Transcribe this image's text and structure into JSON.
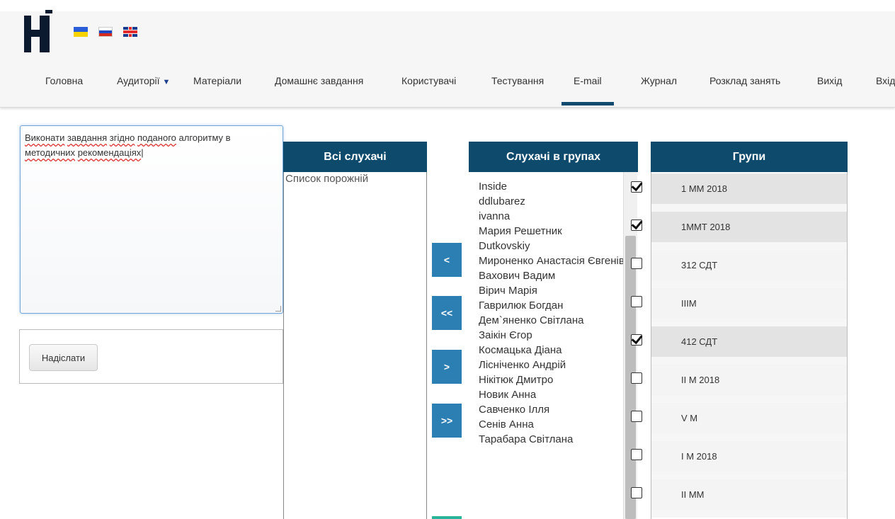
{
  "header": {
    "nav": [
      {
        "label": "Головна"
      },
      {
        "label": "Аудиторії",
        "has_dropdown": true
      },
      {
        "label": "Матеріали"
      },
      {
        "label": "Домашнє завдання"
      },
      {
        "label": "Користувачі"
      },
      {
        "label": "Тестування"
      },
      {
        "label": "E-mail",
        "active": true
      },
      {
        "label": "Журнал"
      },
      {
        "label": "Розклад занять"
      },
      {
        "label": "Вихід"
      },
      {
        "label": "Вхід"
      }
    ],
    "accent_color": "#0e4a6d"
  },
  "message": {
    "text_part1": "Виконати",
    "text_part2": "завдання",
    "text_part3": "згідно",
    "text_part4": "поданого",
    "text_part5": "алгоритму в",
    "text_part6": "методичних",
    "text_part7": "рекомендаціях"
  },
  "send_button": {
    "label": "Надіслати"
  },
  "all_listeners": {
    "title": "Всі слухачі",
    "empty_text": "Список порожній"
  },
  "move_buttons": [
    "<",
    "<<",
    ">",
    ">>"
  ],
  "group_listeners": {
    "title": "Слухачі в групах",
    "names": [
      "Inside",
      "ddlubarez",
      "ivanna",
      "Мария Решетник",
      "Dutkovskiy",
      "Мироненко Анастасія Євгенівна",
      "Вахович Вадим",
      "Вірич Марія",
      "Гаврилюк Богдан",
      "Дем`яненко Світлана",
      "Заікін Єгор",
      "Космацька Діана",
      "Лісніченко Андрій",
      "Нікітюк Дмитро",
      "Новик Анна",
      "Савченко Ілля",
      "Сенів Анна",
      "Тарабара Світлана"
    ]
  },
  "groups": {
    "title": "Групи",
    "items": [
      {
        "label": "1 ММ 2018",
        "checked": true
      },
      {
        "label": "1ММТ 2018",
        "checked": true
      },
      {
        "label": "312 СДТ",
        "checked": false
      },
      {
        "label": "IIIМ",
        "checked": false
      },
      {
        "label": "412 СДТ",
        "checked": true
      },
      {
        "label": "II М 2018",
        "checked": false
      },
      {
        "label": "V М",
        "checked": false
      },
      {
        "label": "I М 2018",
        "checked": false
      },
      {
        "label": "II ММ",
        "checked": false
      }
    ]
  }
}
